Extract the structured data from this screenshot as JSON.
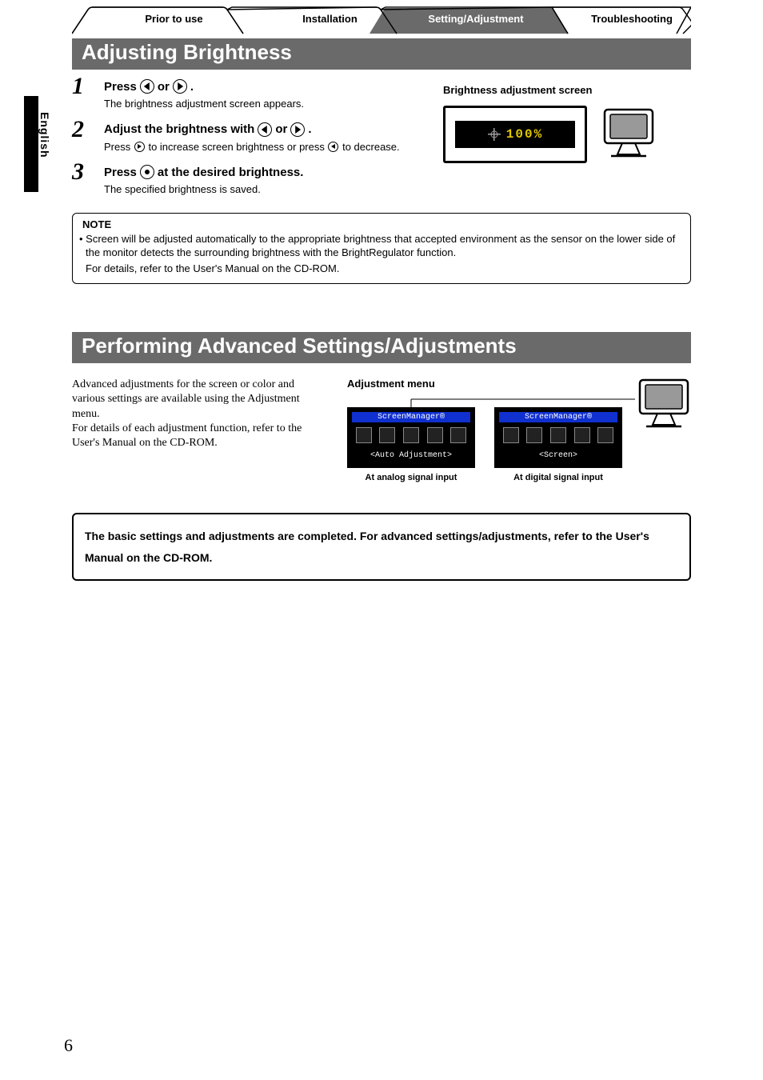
{
  "lang": "English",
  "tabs": {
    "t1": "Prior to use",
    "t2": "Installation",
    "t3": "Setting/Adjustment",
    "t4": "Troubleshooting"
  },
  "section1": {
    "title": "Adjusting Brightness",
    "right_title": "Brightness adjustment screen",
    "osd_value": "100%",
    "steps": [
      {
        "num": "1",
        "head_before": "Press ",
        "head_mid": " or ",
        "head_after": " .",
        "body": "The brightness adjustment screen appears."
      },
      {
        "num": "2",
        "head_before": "Adjust the brightness with ",
        "head_mid": " or ",
        "head_after": " .",
        "body_a": "Press ",
        "body_b": " to increase screen brightness or press ",
        "body_c": " to decrease."
      },
      {
        "num": "3",
        "head_before": "Press ",
        "head_after": " at the desired brightness.",
        "body": "The specified brightness is saved."
      }
    ],
    "note": {
      "title": "NOTE",
      "line1": "• Screen will be adjusted automatically to the appropriate brightness that accepted environment as the sensor on the lower side of the monitor detects the surrounding brightness with the BrightRegulator function.",
      "line2": "For details, refer to the User's Manual on the CD-ROM."
    }
  },
  "section2": {
    "title": "Performing Advanced Settings/Adjustments",
    "left_text_a": "Advanced adjustments for the screen or color and various settings are available using the Adjustment menu.",
    "left_text_b": "For details of each adjustment function, refer to the User's Manual on the CD-ROM.",
    "adj_title": "Adjustment menu",
    "sm_title": "ScreenManager®",
    "sel_analog": "<Auto Adjustment>",
    "sel_digital": "<Screen>",
    "caption_analog": "At analog signal input",
    "caption_digital": "At digital signal input"
  },
  "final_box": "The basic settings and adjustments are completed. For advanced settings/adjustments, refer to the User's Manual on the CD-ROM.",
  "page_number": "6"
}
